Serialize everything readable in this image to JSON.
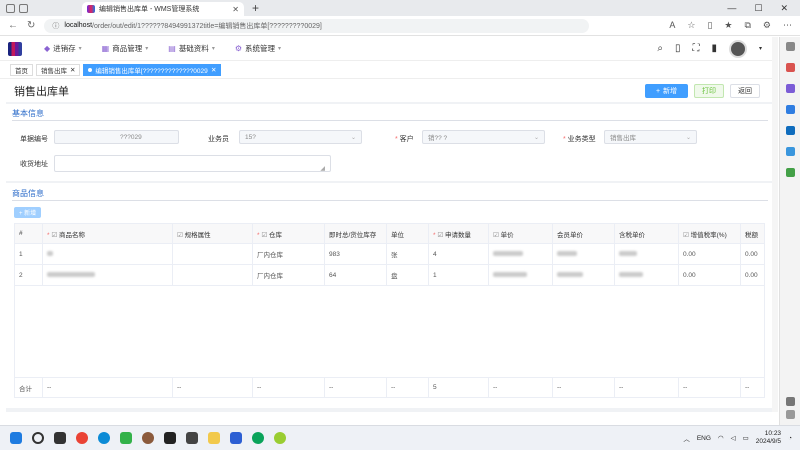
{
  "browser": {
    "tab_title": "编辑销售出库单 - WMS管理系统",
    "url_host": "localhost",
    "url_path": "/order/out/edit/1??????8494991372title=编辑销售出库单[?????????0029]",
    "window_controls": [
      "—",
      "☐",
      "✕"
    ]
  },
  "app": {
    "menu": [
      {
        "label": "进销存",
        "icon": "cart-icon"
      },
      {
        "label": "商品管理",
        "icon": "box-icon"
      },
      {
        "label": "基础资料",
        "icon": "doc-icon"
      },
      {
        "label": "系统管理",
        "icon": "gear-icon"
      }
    ]
  },
  "tags": [
    {
      "label": "首页"
    },
    {
      "label": "销售出库"
    },
    {
      "label": "编辑销售出库单[??????????????0029]"
    }
  ],
  "page": {
    "title": "销售出库单",
    "buttons": {
      "add": "新增",
      "print": "打印",
      "back": "返回"
    }
  },
  "basic": {
    "section_title": "基本信息",
    "order_no_label": "单据编号",
    "order_no_value": "???029",
    "salesman_label": "业务员",
    "salesman_value": "15?",
    "customer_label": "客户",
    "customer_value": "销?? ?",
    "biz_type_label": "业务类型",
    "biz_type_value": "销售出库",
    "address_label": "收货地址",
    "address_value": ""
  },
  "goods": {
    "section_title": "商品信息",
    "add_row": "+ 新增",
    "columns": [
      "#",
      "商品名称",
      "规格属性",
      "仓库",
      "即时总/货位库存",
      "单位",
      "申请数量",
      "单价",
      "会员单价",
      "含税单价",
      "增值税率(%)",
      "税额"
    ],
    "rows": [
      {
        "no": "1",
        "warehouse": "厂内仓库",
        "stock": "983",
        "unit": "张",
        "qty": "4",
        "tax_rate": "0.00",
        "tax": "0.00"
      },
      {
        "no": "2",
        "warehouse": "厂内仓库",
        "stock": "64",
        "unit": "盘",
        "qty": "1",
        "tax_rate": "0.00",
        "tax": "0.00"
      }
    ],
    "footer": [
      "合计",
      "--",
      "--",
      "--",
      "--",
      "--",
      "5",
      "--",
      "--",
      "--",
      "--",
      "--"
    ]
  },
  "taskbar": {
    "lang": "ENG",
    "time": "10:23",
    "date": "2024/9/5"
  },
  "colors": {
    "primary": "#409eff",
    "success": "#67c23a",
    "section": "#2b6bc9"
  }
}
